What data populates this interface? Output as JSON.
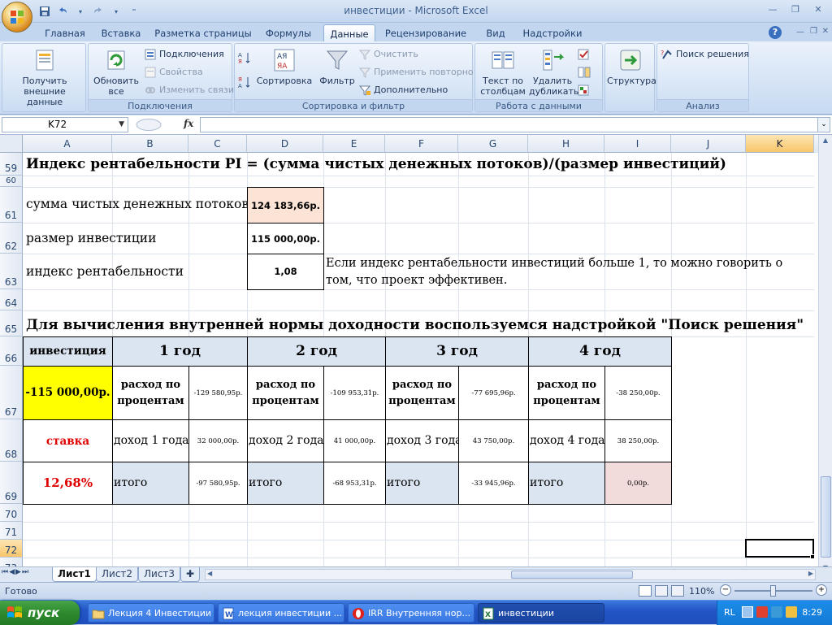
{
  "window": {
    "title": "инвестиции - Microsoft Excel"
  },
  "quick_access": {
    "save_icon": "save-icon",
    "undo_icon": "undo-icon",
    "redo_icon": "redo-icon"
  },
  "tabs": [
    {
      "label": "Главная"
    },
    {
      "label": "Вставка"
    },
    {
      "label": "Разметка страницы"
    },
    {
      "label": "Формулы"
    },
    {
      "label": "Данные"
    },
    {
      "label": "Рецензирование"
    },
    {
      "label": "Вид"
    },
    {
      "label": "Надстройки"
    }
  ],
  "ribbon": {
    "get_external": "Получить внешние данные",
    "refresh_all": "Обновить все",
    "connections": "Подключения",
    "properties": "Свойства",
    "edit_links": "Изменить связи",
    "group_connections": "Подключения",
    "sort": "Сортировка",
    "filter": "Фильтр",
    "clear": "Очистить",
    "reapply": "Применить повторно",
    "advanced": "Дополнительно",
    "group_sort_filter": "Сортировка и фильтр",
    "text_to_columns": "Текст по столбцам",
    "remove_duplicates": "Удалить дубликаты",
    "group_data_tools": "Работа с данными",
    "outline": "Структура",
    "solver": "Поиск решения",
    "group_analysis": "Анализ"
  },
  "formula_bar": {
    "name_box": "K72",
    "fx": "fx",
    "formula": ""
  },
  "columns": [
    "A",
    "B",
    "C",
    "D",
    "E",
    "F",
    "G",
    "H",
    "I",
    "J",
    "K"
  ],
  "rows": [
    "59",
    "60",
    "61",
    "62",
    "63",
    "64",
    "65",
    "66",
    "67",
    "68",
    "69",
    "70",
    "71",
    "72",
    "73"
  ],
  "cells": {
    "r59": "Индекс рентабельности PI = (сумма чистых денежных потоков)/(размер инвестиций)",
    "r61_label": "сумма чистых денежных потоков",
    "r61_value": "124 183,66р.",
    "r62_label": "размер инвестиции",
    "r62_value": "115 000,00р.",
    "r63_label": "индекс рентабельности",
    "r63_value": "1,08",
    "r63_note": "Если индекс рентабельности инвестиций больше 1, то можно говорить о том, что проект эффективен.",
    "r65": "Для вычисления внутренней нормы доходности воспользуемся надстройкой \"Поиск решения\"",
    "table": {
      "h_invest": "инвестиция",
      "years": [
        "1 год",
        "2 год",
        "3 год",
        "4 год"
      ],
      "invest_value": "-115 000,00р.",
      "rate_label": "ставка",
      "rate_value": "12,68%",
      "expense_label": "расход по процентам",
      "expenses": [
        "-129 580,95р.",
        "-109 953,31р.",
        "-77 695,96р.",
        "-38 250,00р."
      ],
      "income_labels": [
        "доход 1 года",
        "доход 2 года",
        "доход 3 года",
        "доход 4 года"
      ],
      "incomes": [
        "32 000,00р.",
        "41 000,00р.",
        "43 750,00р.",
        "38 250,00р."
      ],
      "total_label": "итого",
      "totals": [
        "-97 580,95р.",
        "-68 953,31р.",
        "-33 945,96р.",
        "0,00р."
      ]
    }
  },
  "sheets": [
    "Лист1",
    "Лист2",
    "Лист3"
  ],
  "status": {
    "ready": "Готово",
    "zoom": "110%"
  },
  "taskbar": {
    "start": "пуск",
    "items": [
      "Лекция 4 Инвестиции",
      "лекция инвестиции ...",
      "IRR Внутренняя нор...",
      "инвестиции"
    ],
    "lang": "RL",
    "time": "8:29"
  },
  "colors": {
    "accent_yellow": "#ffff00",
    "header_fill": "#dbe5f1",
    "red_text": "#e00000",
    "peach": "#fbe4d5",
    "pink": "#f2dcdb"
  }
}
